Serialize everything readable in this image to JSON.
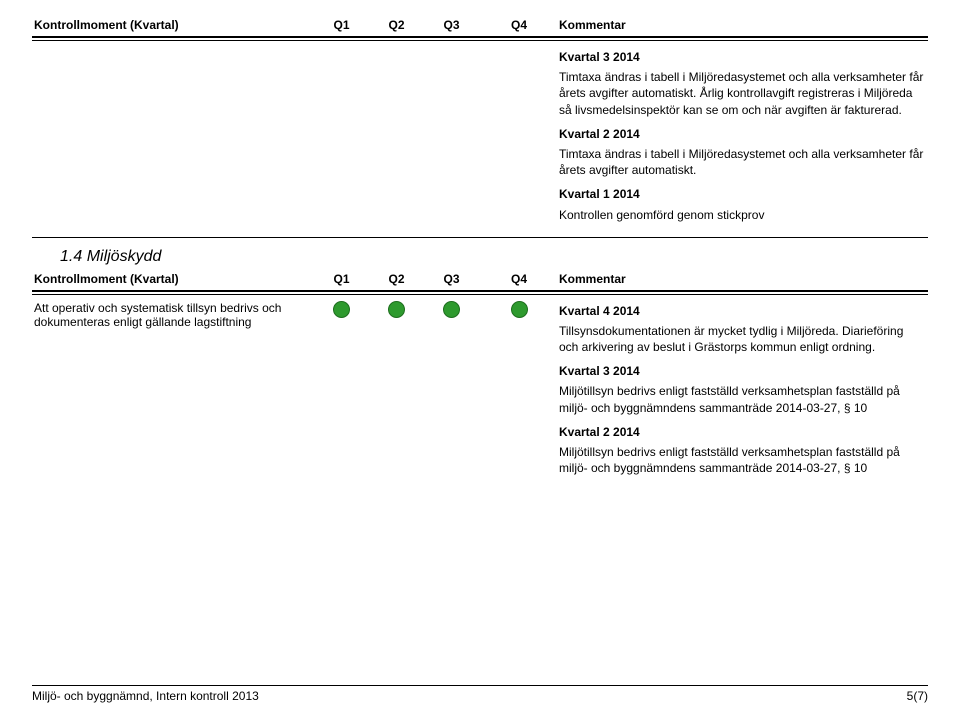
{
  "table_head": {
    "desc": "Kontrollmoment (Kvartal)",
    "q1": "Q1",
    "q2": "Q2",
    "q3": "Q3",
    "q4": "Q4",
    "comment": "Kommentar"
  },
  "sectionA": {
    "comment": {
      "h1": "Kvartal 3 2014",
      "p1": "Timtaxa ändras i tabell i Miljöredasystemet och alla verksamheter får årets avgifter automatiskt. Årlig kontrollavgift registreras i Miljöreda så livsmedelsinspektör kan se om och när avgiften är fakturerad.",
      "h2": "Kvartal 2 2014",
      "p2": "Timtaxa ändras i tabell i Miljöredasystemet och alla verksamheter får årets avgifter automatiskt.",
      "h3": "Kvartal 1 2014",
      "p3": "Kontrollen genomförd genom stickprov"
    }
  },
  "section_title": "1.4 Miljöskydd",
  "sectionB": {
    "desc": "Att operativ och systematisk tillsyn bedrivs och dokumenteras enligt gällande lagstiftning",
    "comment": {
      "h1": "Kvartal 4 2014",
      "p1": "Tillsynsdokumentationen är mycket tydlig i Miljöreda. Diarieföring och arkivering av beslut i Grästorps kommun enligt ordning.",
      "h2": "Kvartal 3 2014",
      "p2": "Miljötillsyn bedrivs enligt fastställd verksamhetsplan fastställd på miljö- och byggnämndens sammanträde 2014-03-27, § 10",
      "h3": "Kvartal 2 2014",
      "p3": "Miljötillsyn bedrivs enligt fastställd verksamhetsplan fastställd på miljö- och byggnämndens sammanträde 2014-03-27, § 10"
    }
  },
  "footer": {
    "left": "Miljö- och byggnämnd, Intern kontroll 2013",
    "right": "5(7)"
  }
}
